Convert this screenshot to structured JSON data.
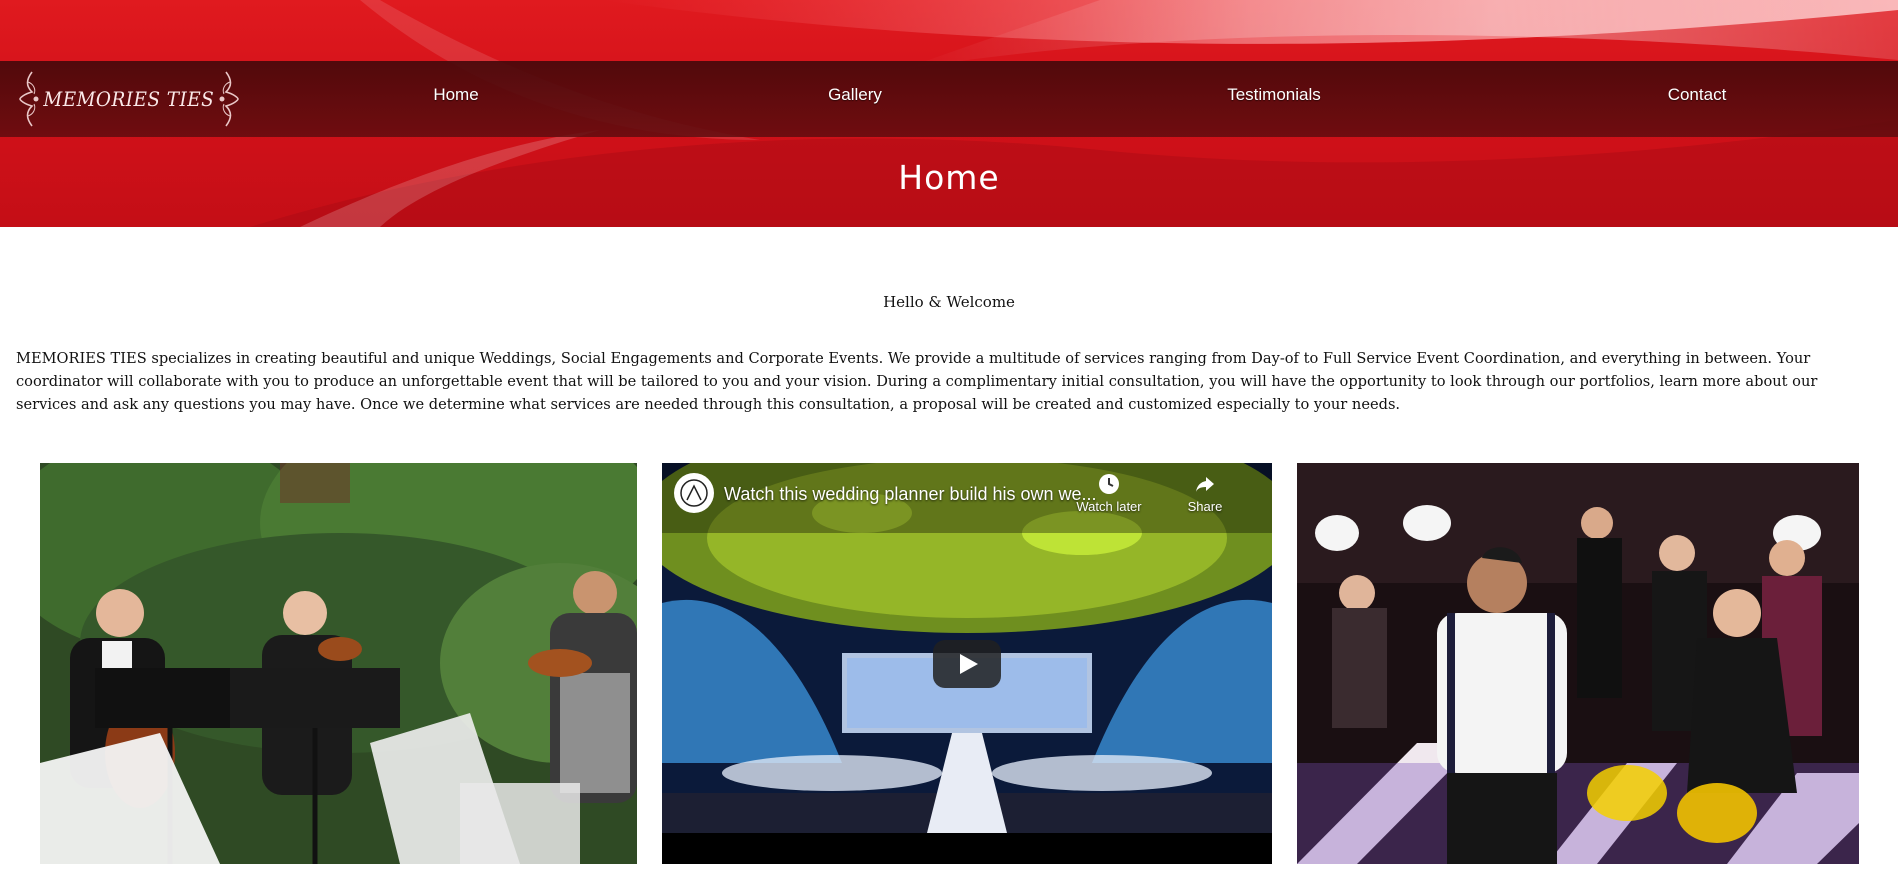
{
  "brand": {
    "logo_text": "MEMORIES TIES"
  },
  "nav": {
    "items": [
      {
        "label": "Home"
      },
      {
        "label": "Gallery"
      },
      {
        "label": "Testimonials"
      },
      {
        "label": "Contact"
      }
    ]
  },
  "page": {
    "title": "Home",
    "welcome": "Hello & Welcome",
    "intro": "MEMORIES TIES specializes in creating beautiful and unique Weddings, Social Engagements and Corporate Events. We provide a multitude of services ranging from Day-of to Full Service Event Coordination, and everything in between. Your coordinator will collaborate with you to produce an unforgettable event that will be tailored to you and your vision. During a complimentary initial consultation, you will have the opportunity to look through our portfolios, learn more about our services and ask any questions you may have. Once we determine what services are needed through this consultation, a proposal will be created and customized especially to your needs."
  },
  "video": {
    "title": "Watch this wedding planner build his own we...",
    "watch_later": "Watch later",
    "share": "Share"
  },
  "colors": {
    "banner_red": "#d4121a",
    "navbar_dark": "#46080a",
    "text": "#111111"
  },
  "icons": [
    "ornament-left-icon",
    "ornament-right-icon",
    "clock-icon",
    "share-icon",
    "play-icon"
  ]
}
